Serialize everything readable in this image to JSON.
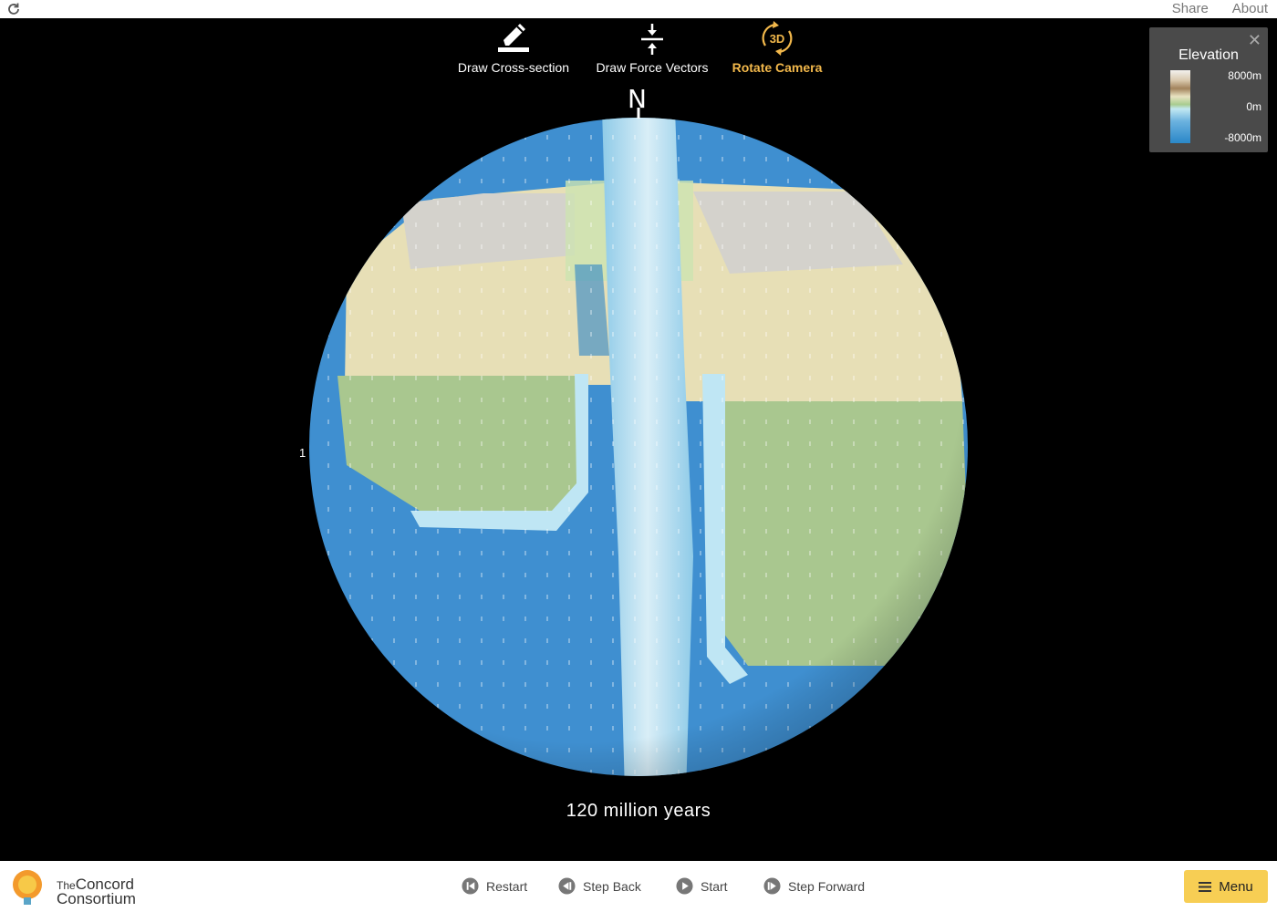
{
  "topbar": {
    "reload_icon": "reload-icon",
    "share_label": "Share",
    "about_label": "About"
  },
  "tools": [
    {
      "label": "Draw Cross-section",
      "icon": "pencil-icon"
    },
    {
      "label": "Draw Force Vectors",
      "icon": "compress-arrows-icon"
    },
    {
      "label": "Rotate Camera",
      "icon": "rotate-3d-icon",
      "icon_text": "3D",
      "active": true
    }
  ],
  "globe": {
    "north_label": "N",
    "latitude_marker": "1",
    "time_label": "120 million years"
  },
  "legend": {
    "title": "Elevation",
    "values": [
      "8000m",
      "0m",
      "-8000m"
    ],
    "close_icon": "close-icon"
  },
  "bottombar": {
    "logo_line1_small": "The",
    "logo_line1": "Concord",
    "logo_line2": "Consortium",
    "controls": [
      {
        "label": "Restart",
        "icon": "restart-icon"
      },
      {
        "label": "Step Back",
        "icon": "step-back-icon"
      },
      {
        "label": "Start",
        "icon": "play-icon"
      },
      {
        "label": "Step Forward",
        "icon": "step-forward-icon"
      }
    ],
    "menu_label": "Menu"
  },
  "colors": {
    "ocean": "#3f8fd0",
    "ocean_shallow": "#bfe6f4",
    "lowland": "#a9c78f",
    "highland": "#e7dfb6",
    "mountain": "#d4d2cc",
    "accent": "#f7ce54",
    "active_tool": "#f2b84b"
  }
}
